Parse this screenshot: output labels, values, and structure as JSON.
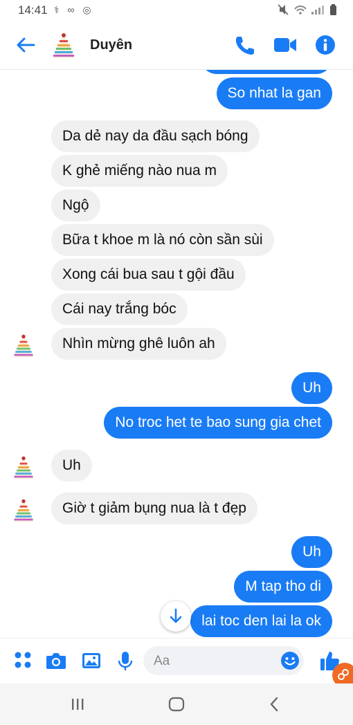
{
  "status_bar": {
    "time": "14:41"
  },
  "header": {
    "contact_name": "Duyên"
  },
  "messages": [
    {
      "side": "out",
      "text": "So nhat la gan"
    },
    {
      "side": "in",
      "text": "Da dẻ nay da đầu sạch bóng"
    },
    {
      "side": "in",
      "text": "K ghẻ miếng nào nua m"
    },
    {
      "side": "in",
      "text": "Ngộ"
    },
    {
      "side": "in",
      "text": "Bữa t khoe m là nó còn sần sùi"
    },
    {
      "side": "in",
      "text": "Xong cái bua sau t gội đầu"
    },
    {
      "side": "in",
      "text": "Cái nay trắng bóc"
    },
    {
      "side": "in",
      "text": "Nhìn mừng ghê luôn ah"
    },
    {
      "side": "out",
      "text": "Uh"
    },
    {
      "side": "out",
      "text": "No troc het te bao sung gia chet"
    },
    {
      "side": "in",
      "text": "Uh"
    },
    {
      "side": "in",
      "text": "Giờ t giảm bụng nua là t đẹp"
    },
    {
      "side": "out",
      "text": "Uh"
    },
    {
      "side": "out",
      "text": "M tap tho di"
    },
    {
      "side": "out",
      "text": "lai toc den lai la ok"
    }
  ],
  "composer": {
    "placeholder": "Aa"
  },
  "colors": {
    "accent": "#1a7cf4",
    "incoming_bubble": "#f1f0f0"
  }
}
